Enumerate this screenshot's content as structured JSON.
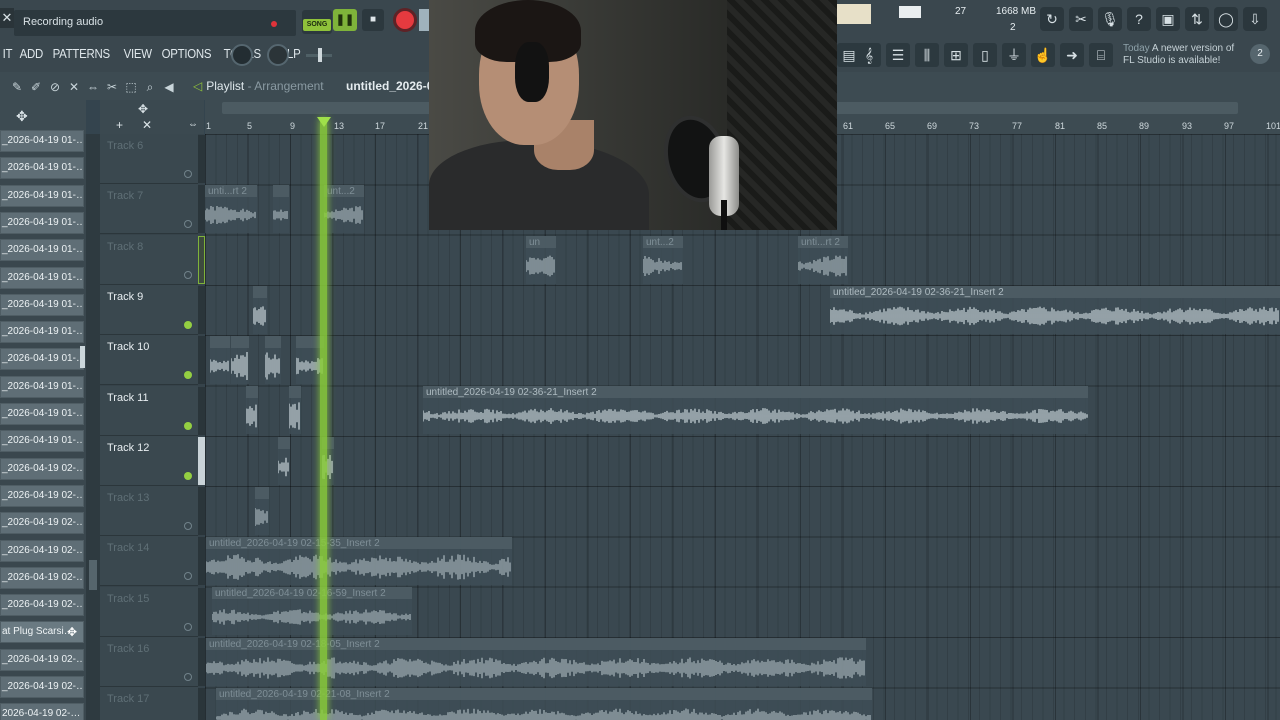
{
  "topbar": {
    "close": "✕",
    "recording_text": "Recording audio",
    "song_mode": "SONG",
    "menu": [
      "IT",
      "ADD",
      "PATTERNS",
      "VIEW",
      "OPTIONS",
      "TOOLS",
      "HELP"
    ],
    "cpu": "27",
    "memory": "1668 MB",
    "poly": "2",
    "news_day": "Today",
    "news_text": "A newer version of FL Studio is available!",
    "news_count": "2"
  },
  "playlist": {
    "title": "Playlist",
    "separator": "-",
    "mode": "Arrangement",
    "file": "untitled_2026-0",
    "ruler_ticks": [
      "1",
      "5",
      "9",
      "13",
      "17",
      "21",
      "61",
      "65",
      "69",
      "73",
      "77",
      "81",
      "85",
      "89",
      "93",
      "97",
      "101"
    ]
  },
  "picker": {
    "items": [
      "_2026-04-19 01-…",
      "_2026-04-19 01-…",
      "_2026-04-19 01-…",
      "_2026-04-19 01-…",
      "_2026-04-19 01-…",
      "_2026-04-19 01-…",
      "_2026-04-19 01-…",
      "_2026-04-19 01-…",
      "_2026-04-19 01-…",
      "_2026-04-19 01-…",
      "_2026-04-19 01-…",
      "_2026-04-19 01-…",
      "_2026-04-19 02-…",
      "_2026-04-19 02-…",
      "_2026-04-19 02-…",
      "_2026-04-19 02-…",
      "_2026-04-19 02-…",
      "_2026-04-19 02-…",
      "at Plug Scarsi…",
      "_2026-04-19 02-…",
      "_2026-04-19 02-…",
      "2026-04-19 02-…"
    ]
  },
  "tracks": [
    {
      "name": "Track 6",
      "dim": true
    },
    {
      "name": "Track 7",
      "dim": true
    },
    {
      "name": "Track 8",
      "dim": true
    },
    {
      "name": "Track 9",
      "dim": false
    },
    {
      "name": "Track 10",
      "dim": false
    },
    {
      "name": "Track 11",
      "dim": false
    },
    {
      "name": "Track 12",
      "dim": false
    },
    {
      "name": "Track 13",
      "dim": true
    },
    {
      "name": "Track 14",
      "dim": true
    },
    {
      "name": "Track 15",
      "dim": true
    },
    {
      "name": "Track 16",
      "dim": true
    },
    {
      "name": "Track 17",
      "dim": true
    }
  ],
  "clips": {
    "t7a": "unti...rt 2",
    "t7b": "unt...2",
    "t8a": "un",
    "t8b": "unt...2",
    "t8c": "unti...rt 2",
    "t9": "untitled_2026-04-19 02-36-21_Insert 2",
    "t11": "untitled_2026-04-19 02-36-21_Insert 2",
    "t14": "untitled_2026-04-19 02-15-35_Insert 2",
    "t15": "untitled_2026-04-19 02-16-59_Insert 2",
    "t16": "untitled_2026-04-19 02-18-05_Insert 2",
    "t17": "untitled_2026-04-19 02-21-08_Insert 2"
  }
}
